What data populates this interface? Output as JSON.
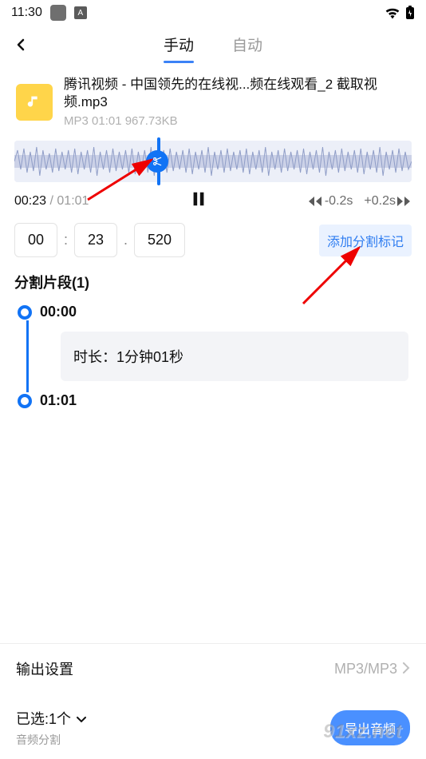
{
  "status_bar": {
    "time": "11:30"
  },
  "tabs": {
    "manual": "手动",
    "auto": "自动"
  },
  "file": {
    "name": "腾讯视频 - 中国领先的在线视...频在线观看_2 截取视频.mp3",
    "meta": "MP3  01:01  967.73KB"
  },
  "player": {
    "current_time": "00:23",
    "total_time": "01:01",
    "skip_back_label": "-0.2s",
    "skip_fwd_label": "+0.2s"
  },
  "time_inputs": {
    "mm": "00",
    "ss": "23",
    "ms": "520"
  },
  "add_marker_label": "添加分割标记",
  "segments": {
    "title": "分割片段(1)",
    "start": "00:00",
    "duration_label": "时长：1分钟01秒",
    "end": "01:01"
  },
  "output": {
    "label": "输出设置",
    "value": "MP3/MP3"
  },
  "bottom": {
    "selected": "已选:1个",
    "sub": "音频分割",
    "export": "导出音频"
  },
  "watermark": "91xz.net"
}
